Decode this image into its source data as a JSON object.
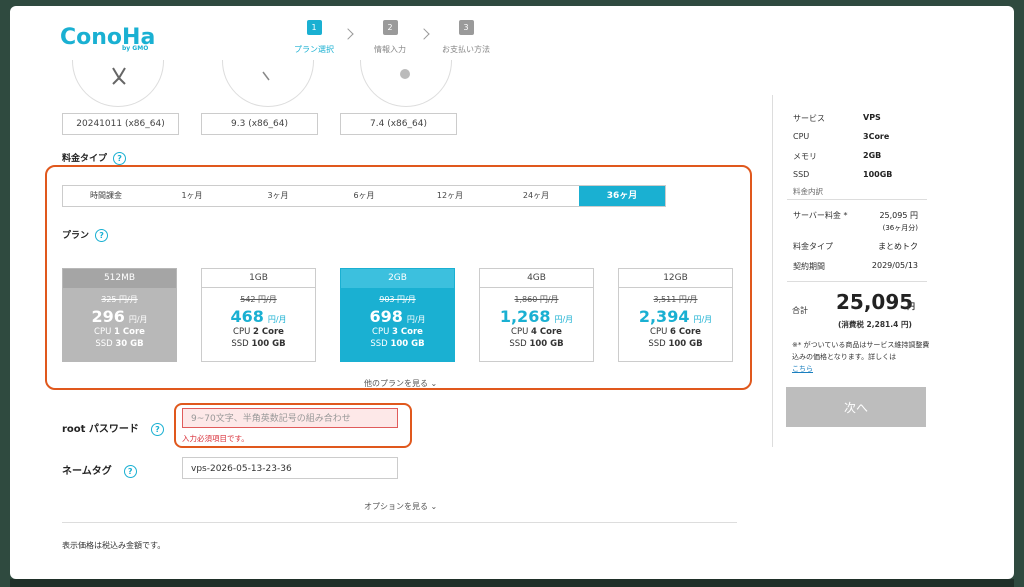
{
  "header": {
    "logo_main": "ConoHa",
    "logo_sub": "by GMO",
    "steps": [
      {
        "num": "1",
        "label": "プラン選択"
      },
      {
        "num": "2",
        "label": "情報入力"
      },
      {
        "num": "3",
        "label": "お支払い方法"
      }
    ]
  },
  "os_versions": [
    "20241011 (x86_64)",
    "9.3 (x86_64)",
    "7.4 (x86_64)"
  ],
  "pricing_type": {
    "label": "料金タイプ",
    "tabs": [
      "時間課金",
      "1ヶ月",
      "3ヶ月",
      "6ヶ月",
      "12ヶ月",
      "24ヶ月",
      "36ヶ月"
    ],
    "selected": "36ヶ月"
  },
  "plan_section": {
    "label": "プラン",
    "unit": "円/月",
    "plans": [
      {
        "name": "512MB",
        "old": "325 円/月",
        "price": "296",
        "cpu": "1 Core",
        "ssd": "30 GB",
        "state": "disabled"
      },
      {
        "name": "1GB",
        "old": "542 円/月",
        "price": "468",
        "cpu": "2 Core",
        "ssd": "100 GB",
        "state": "normal"
      },
      {
        "name": "2GB",
        "old": "903 円/月",
        "price": "698",
        "cpu": "3 Core",
        "ssd": "100 GB",
        "state": "selected"
      },
      {
        "name": "4GB",
        "old": "1,860 円/月",
        "price": "1,268",
        "cpu": "4 Core",
        "ssd": "100 GB",
        "state": "normal"
      },
      {
        "name": "12GB",
        "old": "3,511 円/月",
        "price": "2,394",
        "cpu": "6 Core",
        "ssd": "100 GB",
        "state": "normal"
      }
    ],
    "cpu_label": "CPU",
    "ssd_label": "SSD",
    "more_plans": "他のプランを見る"
  },
  "form": {
    "root_label": "root パスワード",
    "root_placeholder": "9~70文字、半角英数記号の組み合わせ",
    "root_error": "入力必須項目です。",
    "tag_label": "ネームタグ",
    "tag_value": "vps-2026-05-13-23-36",
    "options": "オプションを見る",
    "tax_note": "表示価格は税込み金額です。"
  },
  "summary": {
    "rows": [
      {
        "k": "サービス",
        "v": "VPS"
      },
      {
        "k": "CPU",
        "v": "3Core"
      },
      {
        "k": "メモリ",
        "v": "2GB"
      },
      {
        "k": "SSD",
        "v": "100GB"
      }
    ],
    "breakdown_label": "料金内訳",
    "server_fee_label": "サーバー料金 *",
    "server_fee": "25,095 円",
    "server_fee_sub": "(36ヶ月分)",
    "pricing_type_label": "料金タイプ",
    "pricing_type_value": "まとめトク",
    "contract_label": "契約期間",
    "contract_value": "2029/05/13",
    "total_label": "合計",
    "total_value": "25,095",
    "yen": "円",
    "tax": "(消費税 2,281.4 円)",
    "note": "※* がついている商品はサービス維持調整費込みの価格となります。詳しくは",
    "note_link": "こちら",
    "next_button": "次へ"
  },
  "colors": {
    "accent": "#1ab0d2",
    "highlight": "#e0581d",
    "error": "#d9303a"
  }
}
